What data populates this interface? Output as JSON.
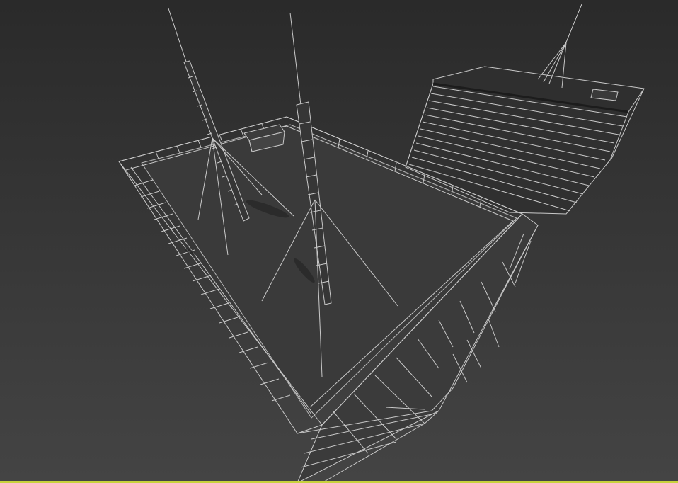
{
  "viewport": {
    "label": "",
    "background_top": "#2a2a2a",
    "background_bottom": "#444444",
    "wire_color": "#c9c9c9",
    "wire_dim_color": "#9a9a9a",
    "active_border_color": "#c8d23c",
    "shading_mode": "wireframe",
    "scene_objects": [
      "rooftop-slab",
      "parapet-wall",
      "antenna-mast-left",
      "antenna-mast-center",
      "antenna-mast-far",
      "roof-hatch",
      "adjacent-tower-block",
      "building-facade"
    ]
  }
}
